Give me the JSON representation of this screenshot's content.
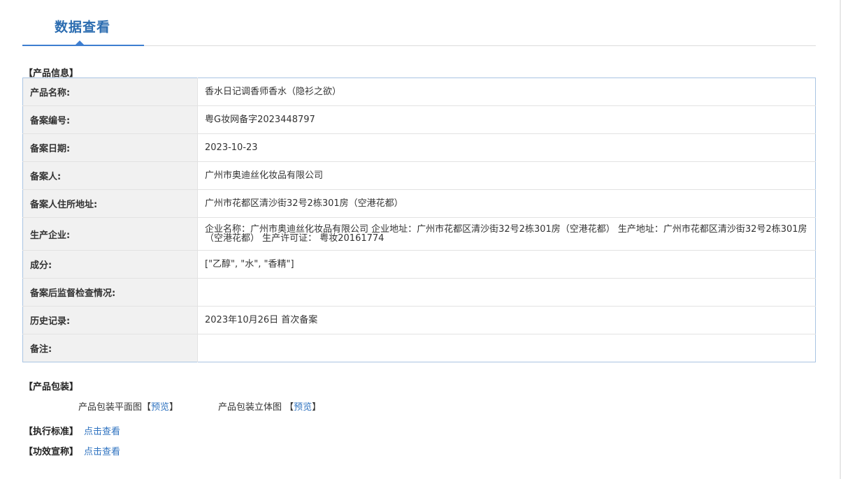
{
  "page": {
    "tab_title": "数据查看"
  },
  "product_info": {
    "section_title": "【产品信息】",
    "rows": [
      {
        "label": "产品名称:",
        "value": "香水日记调香师香水（隐衫之欲）"
      },
      {
        "label": "备案编号:",
        "value": "粤G妆网备字2023448797"
      },
      {
        "label": "备案日期:",
        "value": "2023-10-23"
      },
      {
        "label": "备案人:",
        "value": "广州市奥迪丝化妆品有限公司"
      },
      {
        "label": "备案人住所地址:",
        "value": "广州市花都区清沙街32号2栋301房（空港花都）"
      },
      {
        "label": "生产企业:",
        "value": "企业名称：广州市奥迪丝化妆品有限公司 企业地址：广州市花都区清沙街32号2栋301房（空港花都） 生产地址：广州市花都区清沙街32号2栋301房（空港花都） 生产许可证： 粤妆20161774"
      },
      {
        "label": "成分:",
        "value": "[\"乙醇\", \"水\", \"香精\"]"
      },
      {
        "label": "备案后监督检查情况:",
        "value": ""
      },
      {
        "label": "历史记录:",
        "value": "2023年10月26日 首次备案"
      },
      {
        "label": "备注:",
        "value": ""
      }
    ]
  },
  "packaging": {
    "section_title": "【产品包装】",
    "flat": {
      "label": "产品包装平面图",
      "bracket_open": "【",
      "link": "预览",
      "bracket_close": "】"
    },
    "solid": {
      "label": "产品包装立体图",
      "bracket_open": "【",
      "link": "预览",
      "bracket_close": "】"
    }
  },
  "standard": {
    "section_title": "【执行标准】",
    "link": "点击查看"
  },
  "efficacy": {
    "section_title": "【功效宣称】",
    "link": "点击查看"
  }
}
